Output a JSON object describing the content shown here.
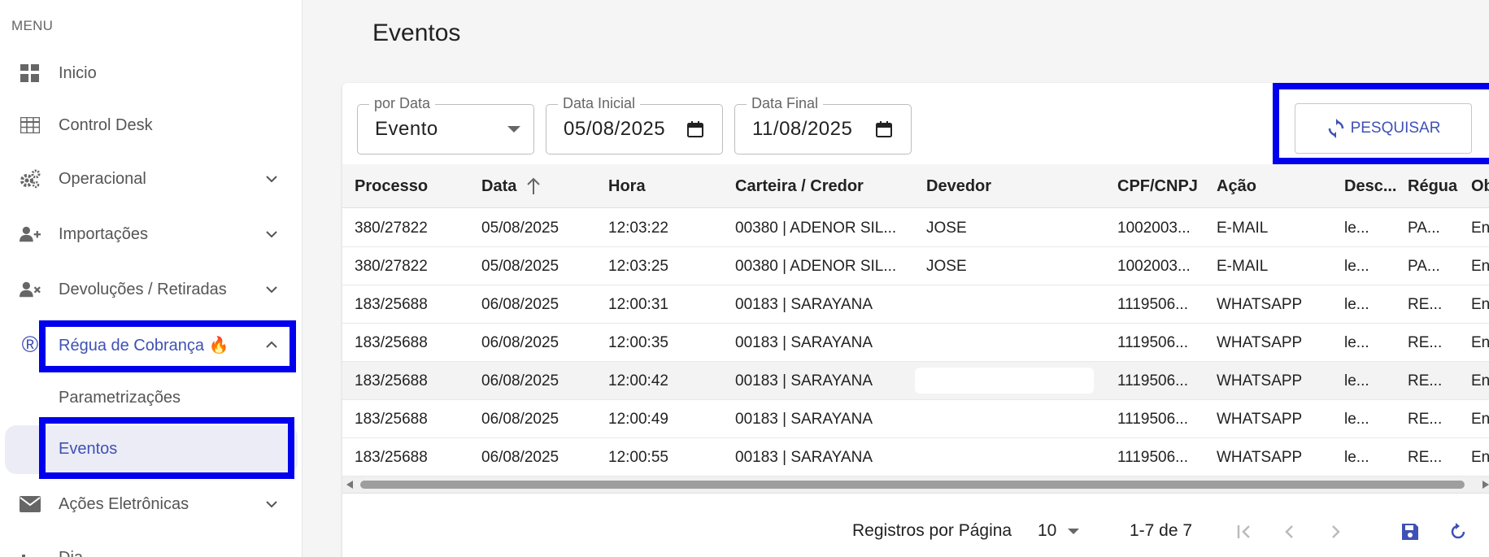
{
  "sidebar": {
    "menu_label": "MENU",
    "items": [
      {
        "label": "Inicio",
        "icon": "dashboard-icon"
      },
      {
        "label": "Control Desk",
        "icon": "table-icon"
      },
      {
        "label": "Operacional",
        "icon": "gears-icon"
      },
      {
        "label": "Importações",
        "icon": "user-plus-icon"
      },
      {
        "label": "Devoluções / Retiradas",
        "icon": "user-x-icon"
      },
      {
        "label": "Régua de Cobrança 🔥",
        "icon": "registered-icon"
      },
      {
        "label": "Ações Eletrônicas",
        "icon": "envelope-icon"
      },
      {
        "label": "Dia..."
      }
    ],
    "sub_items": [
      {
        "label": "Parametrizações"
      },
      {
        "label": "Eventos"
      }
    ]
  },
  "page": {
    "title": "Eventos"
  },
  "filters": {
    "por_data": {
      "label": "por Data",
      "value": "Evento"
    },
    "data_inicial": {
      "label": "Data Inicial",
      "value": "05/08/2025"
    },
    "data_final": {
      "label": "Data Final",
      "value": "11/08/2025"
    },
    "search_button": "PESQUISAR"
  },
  "table": {
    "columns": [
      "Processo",
      "Data",
      "Hora",
      "Carteira / Credor",
      "Devedor",
      "CPF/CNPJ",
      "Ação",
      "Desc...",
      "Régua",
      "Ob"
    ],
    "rows": [
      [
        "380/27822",
        "05/08/2025",
        "12:03:22",
        "00380 | ADENOR SIL...",
        "JOSE",
        "1002003...",
        "E-MAIL",
        "le...",
        "PA...",
        "En"
      ],
      [
        "380/27822",
        "05/08/2025",
        "12:03:25",
        "00380 | ADENOR SIL...",
        "JOSE",
        "1002003...",
        "E-MAIL",
        "le...",
        "PA...",
        "En"
      ],
      [
        "183/25688",
        "06/08/2025",
        "12:00:31",
        "00183 | SARAYANA",
        "",
        "1119506...",
        "WHATSAPP",
        "le...",
        "RE...",
        "En"
      ],
      [
        "183/25688",
        "06/08/2025",
        "12:00:35",
        "00183 | SARAYANA",
        "",
        "1119506...",
        "WHATSAPP",
        "le...",
        "RE...",
        "En"
      ],
      [
        "183/25688",
        "06/08/2025",
        "12:00:42",
        "00183 | SARAYANA",
        "",
        "1119506...",
        "WHATSAPP",
        "le...",
        "RE...",
        "En"
      ],
      [
        "183/25688",
        "06/08/2025",
        "12:00:49",
        "00183 | SARAYANA",
        "",
        "1119506...",
        "WHATSAPP",
        "le...",
        "RE...",
        "En"
      ],
      [
        "183/25688",
        "06/08/2025",
        "12:00:55",
        "00183 | SARAYANA",
        "",
        "1119506...",
        "WHATSAPP",
        "le...",
        "RE...",
        "En"
      ]
    ]
  },
  "pagination": {
    "rows_per_page_label": "Registros por Página",
    "rows_per_page": "10",
    "range": "1-7 de 7"
  },
  "colors": {
    "accent": "#3f51b5",
    "highlight": "#0000ee"
  }
}
